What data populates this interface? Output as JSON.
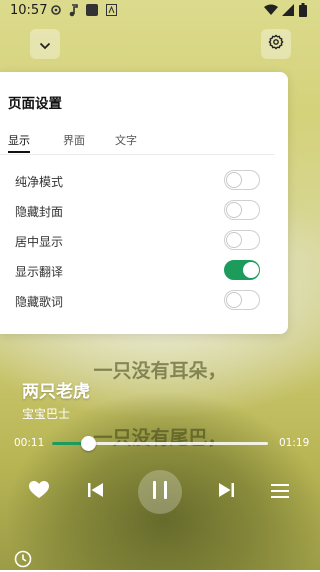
{
  "status_bar": {
    "time": "10:57"
  },
  "page_settings": {
    "title": "页面设置",
    "tabs": [
      {
        "label": "显示",
        "active": true
      },
      {
        "label": "界面",
        "active": false
      },
      {
        "label": "文字",
        "active": false
      }
    ],
    "options": [
      {
        "label": "纯净模式",
        "enabled": false
      },
      {
        "label": "隐藏封面",
        "enabled": false
      },
      {
        "label": "居中显示",
        "enabled": false
      },
      {
        "label": "显示翻译",
        "enabled": true
      },
      {
        "label": "隐藏歌词",
        "enabled": false
      }
    ]
  },
  "lyrics": {
    "line1": "一只没有耳朵，",
    "line2": "一只没有尾巴，"
  },
  "song": {
    "title": "两只老虎",
    "artist": "宝宝巴士"
  },
  "progress": {
    "current": "00:11",
    "total": "01:19",
    "fraction": 0.17
  },
  "colors": {
    "accent": "#1c9b5b"
  }
}
